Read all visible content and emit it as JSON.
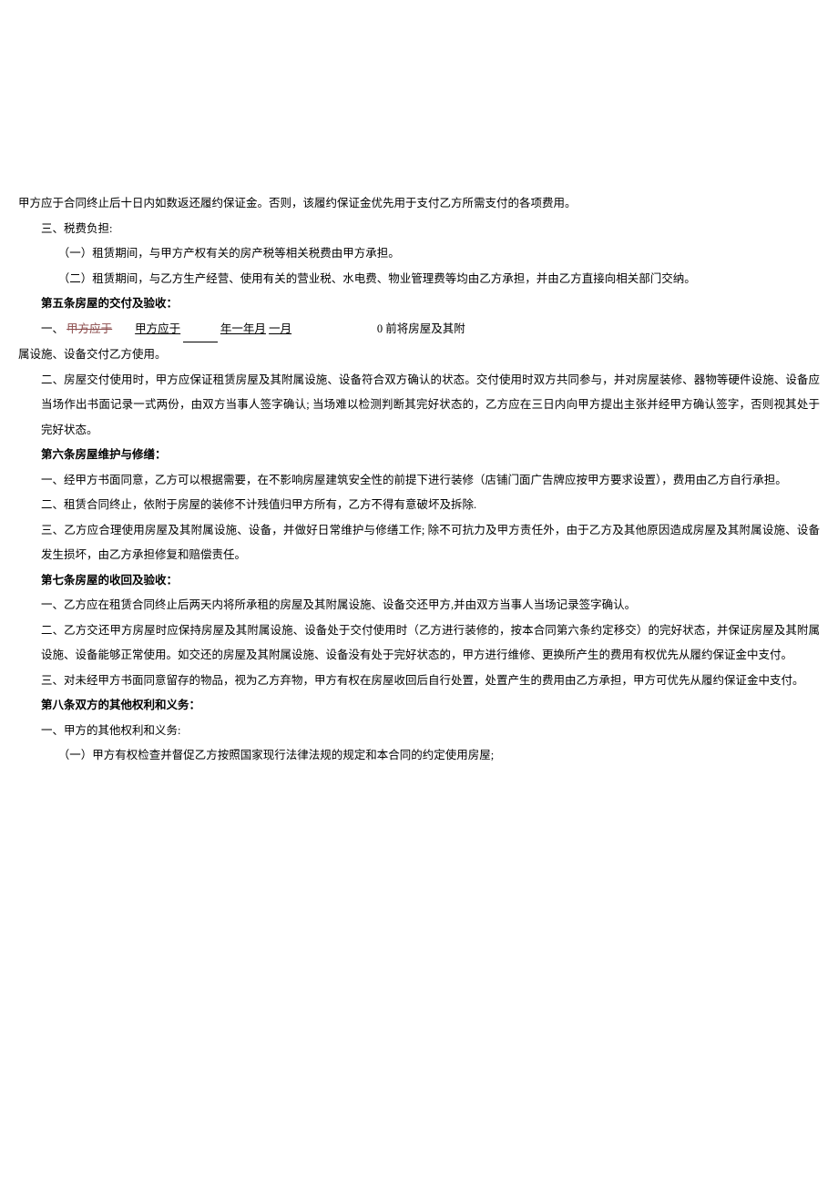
{
  "p1": "甲方应于合同终止后十日内如数返还履约保证金。否则，该履约保证金优先用于支付乙方所需支付的各项费用。",
  "p2": "三、税费负担:",
  "p3": "（一）租赁期间，与甲方产权有关的房产税等相关税费由甲方承担。",
  "p4": "（二）租赁期间，与乙方生产经营、使用有关的营业税、水电费、物业管理费等均由乙方承担，并由乙方直接向相关部门交纳。",
  "h5": "第五条房屋的交付及验收：",
  "p5a": "一、",
  "p5b": "甲方应于",
  "p5c": "甲方应于",
  "p5d": "年一年月",
  "p5e": "一月",
  "p5f": "0 前将房屋及其附",
  "p5g": "属设施、设备交付乙方使用。",
  "p6": "二、房屋交付使用时，甲方应保证租赁房屋及其附属设施、设备符合双方确认的状态。交付使用时双方共同参与，并对房屋装修、器物等硬件设施、设备应当场作出书面记录一式两份，由双方当事人签字确认; 当场难以检测判断其完好状态的，乙方应在三日内向甲方提出主张并经甲方确认签字，否则视其处于完好状态。",
  "h6": "第六条房屋维护与修缮：",
  "p7": "一、经甲方书面同意，乙方可以根据需要，在不影响房屋建筑安全性的前提下进行装修（店铺门面广告牌应按甲方要求设置），费用由乙方自行承担。",
  "p8": "二、租赁合同终止，依附于房屋的装修不计残值归甲方所有，乙方不得有意破坏及拆除.",
  "p9": "三、乙方应合理使用房屋及其附属设施、设备，并做好日常维护与修缮工作; 除不可抗力及甲方责任外，由于乙方及其他原因造成房屋及其附属设施、设备发生损坏，由乙方承担修复和赔偿责任。",
  "h7": "第七条房屋的收回及验收：",
  "p10": "一、乙方应在租赁合同终止后两天内将所承租的房屋及其附属设施、设备交还甲方,并由双方当事人当场记录签字确认。",
  "p11": "二、乙方交还甲方房屋时应保持房屋及其附属设施、设备处于交付使用时（乙方进行装修的，按本合同第六条约定移交）的完好状态，并保证房屋及其附属设施、设备能够正常使用。如交还的房屋及其附属设施、设备没有处于完好状态的，甲方进行维修、更换所产生的费用有权优先从履约保证金中支付。",
  "p12": "三、对未经甲方书面同意留存的物品，视为乙方弃物，甲方有权在房屋收回后自行处置，处置产生的费用由乙方承担，甲方可优先从履约保证金中支付。",
  "h8": "第八条双方的其他权利和义务：",
  "p13": "一、甲方的其他权利和义务:",
  "p14": "（一）甲方有权检查并督促乙方按照国家现行法律法规的规定和本合同的约定使用房屋;"
}
